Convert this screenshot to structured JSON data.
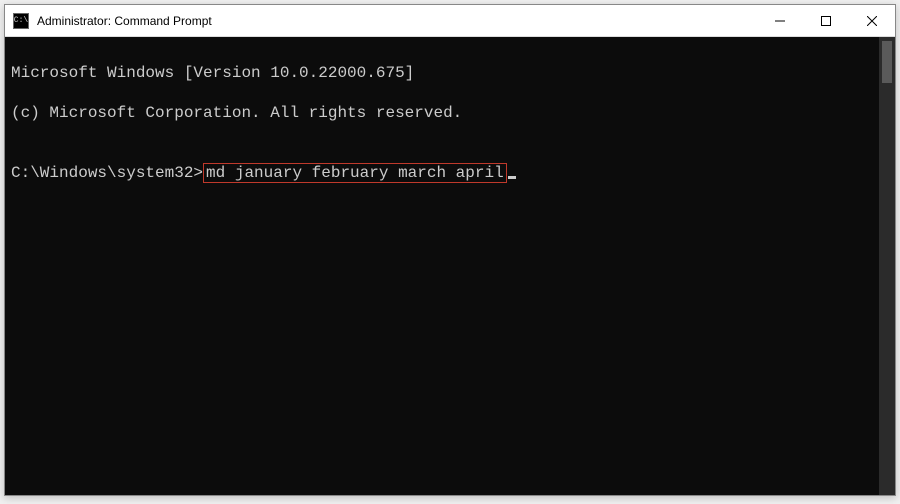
{
  "window": {
    "title": "Administrator: Command Prompt",
    "icon_label": "C:\\"
  },
  "terminal": {
    "line1": "Microsoft Windows [Version 10.0.22000.675]",
    "line2": "(c) Microsoft Corporation. All rights reserved.",
    "blank": "",
    "prompt": "C:\\Windows\\system32>",
    "command": "md january february march april"
  },
  "annotation": {
    "highlight_color": "#c0392b"
  }
}
